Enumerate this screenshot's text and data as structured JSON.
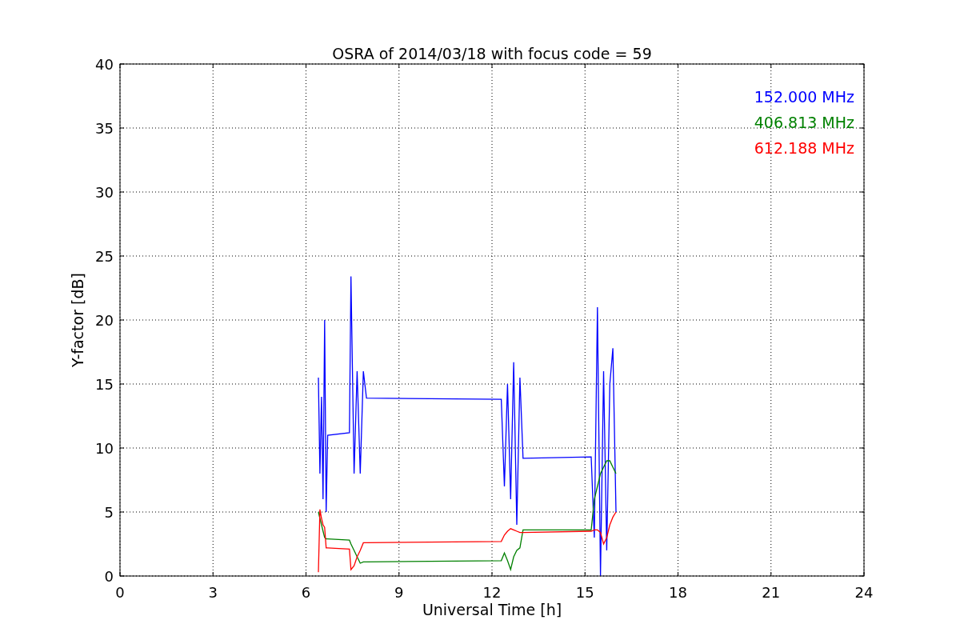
{
  "chart_data": {
    "type": "line",
    "title": "OSRA of 2014/03/18 with focus code = 59",
    "xlabel": "Universal Time [h]",
    "ylabel": "Y-factor [dB]",
    "x": [
      6.4,
      6.45,
      6.5,
      6.55,
      6.6,
      6.65,
      6.7,
      7.4,
      7.45,
      7.55,
      7.65,
      7.75,
      7.85,
      7.95,
      12.3,
      12.4,
      12.5,
      12.6,
      12.7,
      12.8,
      12.9,
      13.0,
      15.2,
      15.3,
      15.4,
      15.5,
      15.6,
      15.7,
      15.8,
      15.9,
      16.0
    ],
    "series": [
      {
        "name": "152.000 MHz",
        "color": "#0000ff",
        "values": [
          15.5,
          8,
          14,
          6,
          20,
          5,
          11,
          11.2,
          23.4,
          8,
          16,
          8,
          16,
          13.9,
          13.8,
          7,
          15,
          6,
          16.7,
          4,
          15.5,
          9.2,
          9.3,
          3,
          21,
          0,
          16,
          2,
          15,
          17.8,
          5
        ]
      },
      {
        "name": "406.813 MHz",
        "color": "#008000",
        "values": [
          5,
          4.5,
          4,
          3.5,
          3,
          2.9,
          2.9,
          2.8,
          2.5,
          2,
          1.5,
          1,
          1.1,
          1.1,
          1.2,
          1.8,
          1.2,
          0.5,
          1.5,
          2,
          2.2,
          3.6,
          3.6,
          6,
          7,
          8,
          8.5,
          9,
          9,
          8.5,
          8
        ]
      },
      {
        "name": "612.188 MHz",
        "color": "#ff0000",
        "values": [
          0.3,
          5.2,
          4.5,
          4,
          3.8,
          2.2,
          2.2,
          2.1,
          0.5,
          0.8,
          1.5,
          2,
          2.6,
          2.6,
          2.7,
          3.2,
          3.5,
          3.7,
          3.6,
          3.5,
          3.4,
          3.4,
          3.5,
          3.6,
          3.6,
          3.4,
          2.5,
          3,
          4,
          4.6,
          5
        ]
      }
    ],
    "xlim": [
      0,
      24
    ],
    "ylim": [
      0,
      40
    ],
    "xticks": [
      0,
      3,
      6,
      9,
      12,
      15,
      18,
      21,
      24
    ],
    "yticks": [
      0,
      5,
      10,
      15,
      20,
      25,
      30,
      35,
      40
    ],
    "grid": true
  }
}
